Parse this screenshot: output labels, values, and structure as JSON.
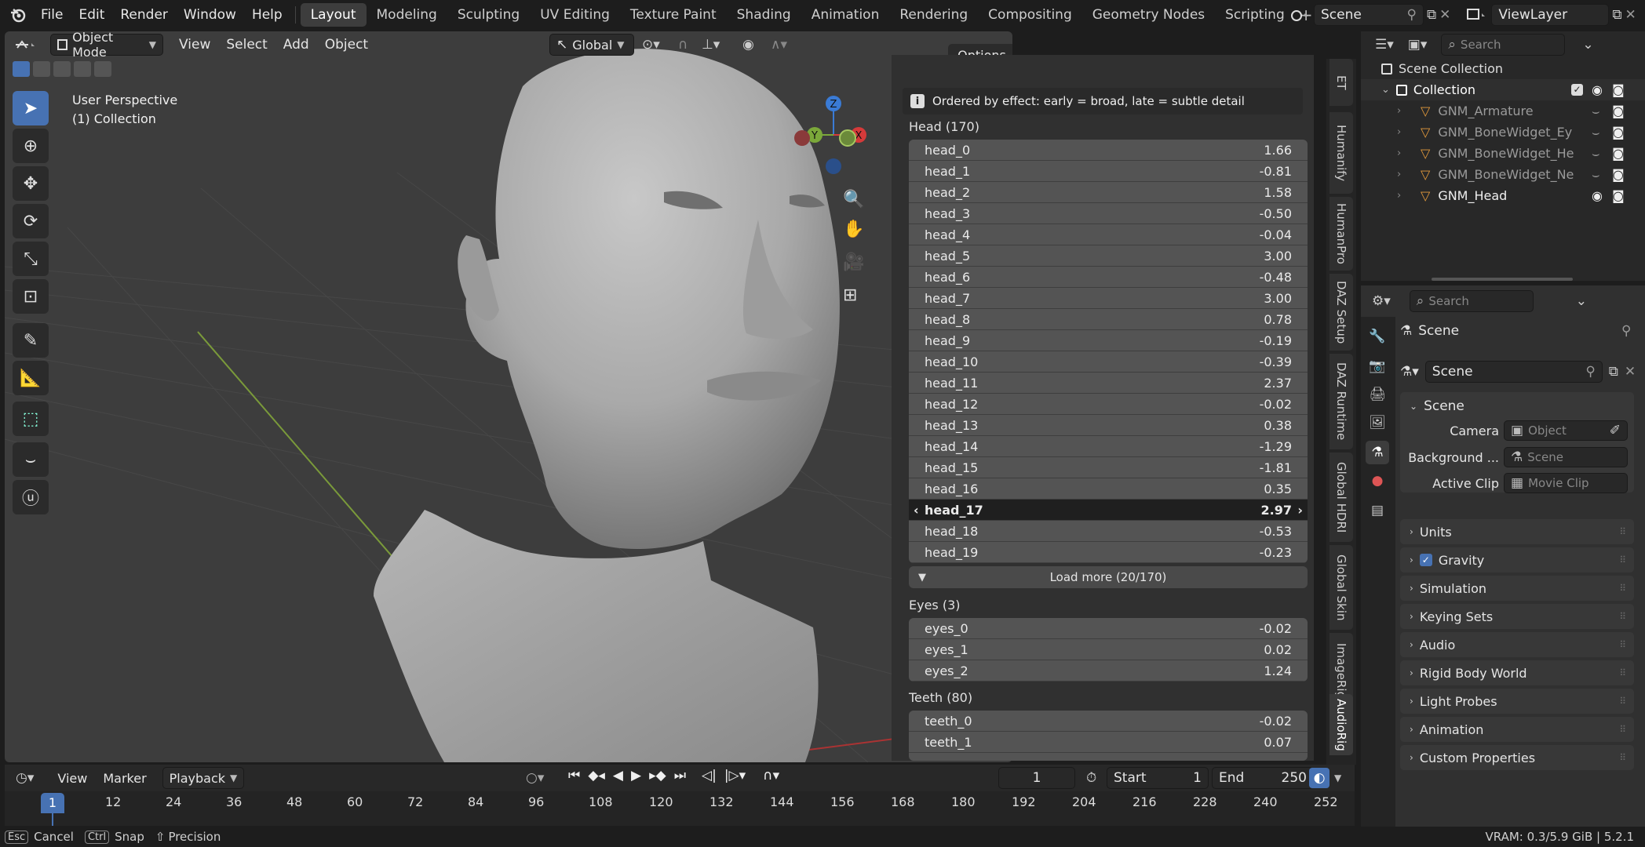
{
  "menu": [
    "File",
    "Edit",
    "Render",
    "Window",
    "Help"
  ],
  "workspaces": [
    "Layout",
    "Modeling",
    "Sculpting",
    "UV Editing",
    "Texture Paint",
    "Shading",
    "Animation",
    "Rendering",
    "Compositing",
    "Geometry Nodes",
    "Scripting"
  ],
  "active_workspace": "Layout",
  "scene_name": "Scene",
  "view_layer": "ViewLayer",
  "viewport": {
    "mode": "Object Mode",
    "menus": [
      "View",
      "Select",
      "Add",
      "Object"
    ],
    "orientation": "Global",
    "options_label": "Options",
    "perspective": "User Perspective",
    "collection": "(1) Collection",
    "gizmo_axes": {
      "x": "X",
      "y": "Y",
      "z": "Z"
    }
  },
  "npanel": {
    "info": "Ordered by effect: early = broad, late = subtle detail",
    "head_title": "Head (170)",
    "head_rows": [
      {
        "name": "head_0",
        "value": "1.66"
      },
      {
        "name": "head_1",
        "value": "-0.81"
      },
      {
        "name": "head_2",
        "value": "1.58"
      },
      {
        "name": "head_3",
        "value": "-0.50"
      },
      {
        "name": "head_4",
        "value": "-0.04"
      },
      {
        "name": "head_5",
        "value": "3.00"
      },
      {
        "name": "head_6",
        "value": "-0.48"
      },
      {
        "name": "head_7",
        "value": "3.00"
      },
      {
        "name": "head_8",
        "value": "0.78"
      },
      {
        "name": "head_9",
        "value": "-0.19"
      },
      {
        "name": "head_10",
        "value": "-0.39"
      },
      {
        "name": "head_11",
        "value": "2.37"
      },
      {
        "name": "head_12",
        "value": "-0.02"
      },
      {
        "name": "head_13",
        "value": "0.38"
      },
      {
        "name": "head_14",
        "value": "-1.29"
      },
      {
        "name": "head_15",
        "value": "-1.81"
      },
      {
        "name": "head_16",
        "value": "0.35"
      },
      {
        "name": "head_17",
        "value": "2.97"
      },
      {
        "name": "head_18",
        "value": "-0.53"
      },
      {
        "name": "head_19",
        "value": "-0.23"
      }
    ],
    "load_more": "Load more (20/170)",
    "eyes_title": "Eyes (3)",
    "eyes_rows": [
      {
        "name": "eyes_0",
        "value": "-0.02"
      },
      {
        "name": "eyes_1",
        "value": "0.02"
      },
      {
        "name": "eyes_2",
        "value": "1.24"
      }
    ],
    "teeth_title": "Teeth (80)",
    "teeth_rows": [
      {
        "name": "teeth_0",
        "value": "-0.02"
      },
      {
        "name": "teeth_1",
        "value": "0.07"
      }
    ],
    "side_tabs": [
      "ET",
      "Humanify",
      "HumanPro",
      "DAZ Setup",
      "DAZ Runtime",
      "Global HDRI",
      "Global Skin",
      "ImageRig",
      "AudioRig"
    ]
  },
  "outliner": {
    "search_placeholder": "Search",
    "root": "Scene Collection",
    "collection": "Collection",
    "items": [
      "GNM_Armature",
      "GNM_BoneWidget_Ey",
      "GNM_BoneWidget_He",
      "GNM_BoneWidget_Ne",
      "GNM_Head"
    ]
  },
  "properties": {
    "search_placeholder": "Search",
    "context": "Scene",
    "scene_field": "Scene",
    "scene_panel": "Scene",
    "camera_label": "Camera",
    "camera_value": "Object",
    "background_label": "Background ...",
    "background_value": "Scene",
    "clip_label": "Active Clip",
    "clip_value": "Movie Clip",
    "sections": [
      "Units",
      "Gravity",
      "Simulation",
      "Keying Sets",
      "Audio",
      "Rigid Body World",
      "Light Probes",
      "Animation",
      "Custom Properties"
    ]
  },
  "timeline": {
    "menus": [
      "View",
      "Marker",
      "Playback"
    ],
    "current_frame": "1",
    "start_label": "Start",
    "start": "1",
    "end_label": "End",
    "end": "250",
    "ticks": [
      "12",
      "24",
      "36",
      "48",
      "60",
      "72",
      "84",
      "96",
      "108",
      "120",
      "132",
      "144",
      "156",
      "168",
      "180",
      "192",
      "204",
      "216",
      "228",
      "240",
      "252"
    ]
  },
  "status": {
    "cancel_key": "Esc",
    "cancel": "Cancel",
    "snap_key": "Ctrl",
    "snap": "Snap",
    "precision": "Precision",
    "vram": "VRAM: 0.3/5.9 GiB | 5.2.1"
  }
}
